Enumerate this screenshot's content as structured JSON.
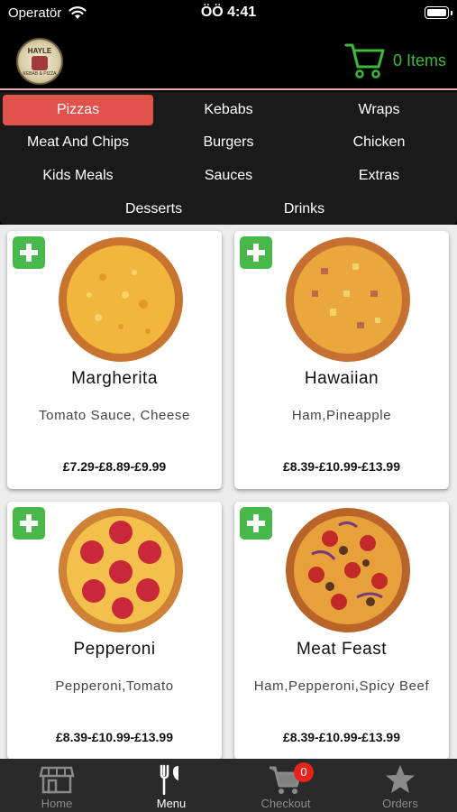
{
  "status_bar": {
    "carrier": "Operatör",
    "time": "ÖÖ 4:41"
  },
  "header": {
    "logo_text": "HAYLE",
    "logo_sub": "KEBAB & PIZZA",
    "cart_count_label": "0 Items"
  },
  "categories": [
    {
      "label": "Pizzas",
      "active": true
    },
    {
      "label": "Kebabs"
    },
    {
      "label": "Wraps"
    },
    {
      "label": "Meat And Chips"
    },
    {
      "label": "Burgers"
    },
    {
      "label": "Chicken"
    },
    {
      "label": "Kids Meals"
    },
    {
      "label": "Sauces"
    },
    {
      "label": "Extras"
    },
    {
      "label": "Desserts"
    },
    {
      "label": "Drinks"
    }
  ],
  "items": [
    {
      "name": "Margherita",
      "description": "Tomato Sauce, Cheese",
      "price": "£7.29-£8.89-£9.99",
      "topping": "cheese"
    },
    {
      "name": "Hawaiian",
      "description": "Ham,Pineapple",
      "price": "£8.39-£10.99-£13.99",
      "topping": "ham-pineapple"
    },
    {
      "name": "Pepperoni",
      "description": "Pepperoni,Tomato",
      "price": "£8.39-£10.99-£13.99",
      "topping": "pepperoni"
    },
    {
      "name": "Meat Feast",
      "description": "Ham,Pepperoni,Spicy Beef",
      "price": "£8.39-£10.99-£13.99",
      "topping": "meat-feast"
    }
  ],
  "tabs": [
    {
      "label": "Home",
      "icon": "store-icon"
    },
    {
      "label": "Menu",
      "icon": "cutlery-icon",
      "active": true
    },
    {
      "label": "Checkout",
      "icon": "cart-icon",
      "badge": "0"
    },
    {
      "label": "Orders",
      "icon": "star-icon"
    }
  ],
  "colors": {
    "accent_green": "#3dbb3d",
    "active_category": "#e0524a",
    "badge_red": "#e8231b",
    "tab_bar": "#2a2a2a"
  }
}
